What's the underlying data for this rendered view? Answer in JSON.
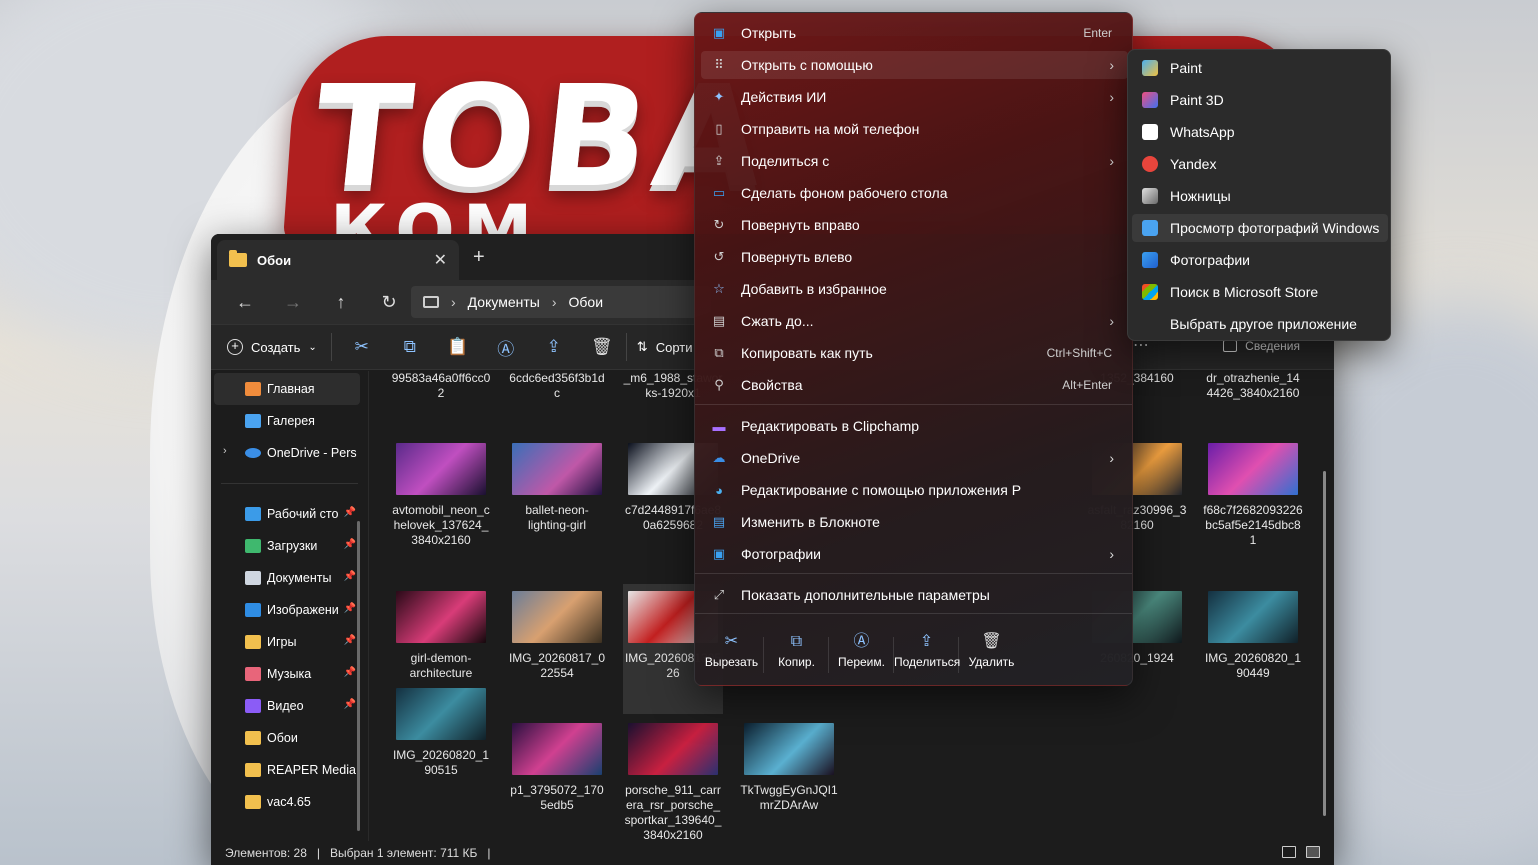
{
  "wallpaper": {
    "logo_line1": "ТОВА",
    "logo_line2": "КОМ"
  },
  "explorer": {
    "tab_title": "Обои",
    "new_tab": "+",
    "breadcrumb": [
      "Документы",
      "Обои"
    ],
    "toolbar": {
      "create_label": "Создать",
      "sort_label": "Сорти",
      "details_label": "Сведения"
    },
    "sidebar": [
      {
        "label": "Главная",
        "icon": "home-icon",
        "active": true
      },
      {
        "label": "Галерея",
        "icon": "gallery-icon"
      },
      {
        "label": "OneDrive - Pers",
        "icon": "onedrive-icon",
        "expandable": true
      },
      {
        "label": "Рабочий сто",
        "icon": "desktop-icon",
        "pinned": true
      },
      {
        "label": "Загрузки",
        "icon": "download-icon",
        "pinned": true
      },
      {
        "label": "Документы",
        "icon": "documents-icon",
        "pinned": true
      },
      {
        "label": "Изображени",
        "icon": "pictures-icon",
        "pinned": true
      },
      {
        "label": "Игры",
        "icon": "folder-icon",
        "pinned": true
      },
      {
        "label": "Музыка",
        "icon": "music-icon",
        "pinned": true
      },
      {
        "label": "Видео",
        "icon": "video-icon",
        "pinned": true
      },
      {
        "label": "Обои",
        "icon": "folder-icon"
      },
      {
        "label": "REAPER Media",
        "icon": "folder-icon"
      },
      {
        "label": "vac4.65",
        "icon": "folder-icon"
      }
    ],
    "files": [
      {
        "name": "99583a46a0ff6cc02",
        "thumb": false
      },
      {
        "name": "6cdc6ed356f3b1dc",
        "thumb": false
      },
      {
        "name": "_m6_1988_staworks-1920x1",
        "thumb": false
      },
      {
        "name": "1352_384160",
        "thumb": false
      },
      {
        "name": "dr_otrazhenie_144426_3840x2160",
        "thumb": false
      },
      {
        "name": "avtomobil_neon_chelovek_137624_3840x2160"
      },
      {
        "name": "ballet-neon-lighting-girl"
      },
      {
        "name": "c7d2448917f6ae80a6259682"
      },
      {
        "name": "asfalt_raz30996_382160"
      },
      {
        "name": "f68c7f2682093226bc5af5e2145dbc81"
      },
      {
        "name": "girl-demon-architecture"
      },
      {
        "name": "IMG_20260817_022554"
      },
      {
        "name": "IMG_202608130526",
        "selected": true
      },
      {
        "name": "260820_1924"
      },
      {
        "name": "IMG_20260820_190449"
      },
      {
        "name": "IMG_20260820_190515"
      },
      {
        "name": "p1_3795072_1705edb5"
      },
      {
        "name": "porsche_911_carrera_rsr_porsche_sportkar_139640_3840x2160"
      },
      {
        "name": "TkTwggEyGnJQI1mrZDArAw"
      }
    ],
    "status": {
      "count": "Элементов: 28",
      "selected": "Выбран 1 элемент: 711 КБ"
    }
  },
  "context_menu": {
    "items": [
      {
        "label": "Открыть",
        "shortcut": "Enter",
        "icon": "photos-icon"
      },
      {
        "label": "Открыть с помощью",
        "submenu": true,
        "icon": "open-with-icon",
        "hover": true
      },
      {
        "label": "Действия ИИ",
        "submenu": true,
        "icon": "ai-sparkle-icon"
      },
      {
        "label": "Отправить на мой телефон",
        "icon": "phone-icon"
      },
      {
        "label": "Поделиться с",
        "submenu": true,
        "icon": "share-icon"
      },
      {
        "label": "Сделать фоном рабочего стола",
        "icon": "wallpaper-icon"
      },
      {
        "label": "Повернуть вправо",
        "icon": "rotate-right-icon"
      },
      {
        "label": "Повернуть влево",
        "icon": "rotate-left-icon"
      },
      {
        "label": "Добавить в избранное",
        "icon": "star-icon"
      },
      {
        "label": "Сжать до...",
        "submenu": true,
        "icon": "zip-icon"
      },
      {
        "label": "Копировать как путь",
        "shortcut": "Ctrl+Shift+C",
        "icon": "copy-path-icon"
      },
      {
        "label": "Свойства",
        "shortcut": "Alt+Enter",
        "icon": "wrench-icon"
      },
      {
        "label": "Редактировать в Clipchamp",
        "icon": "clipchamp-icon"
      },
      {
        "label": "OneDrive",
        "submenu": true,
        "icon": "onedrive-icon"
      },
      {
        "label": "Редактирование с помощью приложения P",
        "icon": "paint-icon"
      },
      {
        "label": "Изменить в Блокноте",
        "icon": "notepad-icon"
      },
      {
        "label": "Фотографии",
        "submenu": true,
        "icon": "photos-icon"
      },
      {
        "label": "Показать дополнительные параметры",
        "icon": "more-options-icon"
      }
    ],
    "actions": [
      {
        "label": "Вырезать",
        "icon": "cut-icon"
      },
      {
        "label": "Копир.",
        "icon": "copy-icon"
      },
      {
        "label": "Переим.",
        "icon": "rename-icon"
      },
      {
        "label": "Поделиться",
        "icon": "share-icon"
      },
      {
        "label": "Удалить",
        "icon": "delete-icon"
      }
    ]
  },
  "submenu": {
    "items": [
      {
        "label": "Paint",
        "icon": "paint-icon"
      },
      {
        "label": "Paint 3D",
        "icon": "paint3d-icon"
      },
      {
        "label": "WhatsApp",
        "icon": "whatsapp-icon"
      },
      {
        "label": "Yandex",
        "icon": "yandex-icon"
      },
      {
        "label": "Ножницы",
        "icon": "snipping-icon"
      },
      {
        "label": "Просмотр фотографий Windows",
        "icon": "photo-viewer-icon",
        "hover": true
      },
      {
        "label": "Фотографии",
        "icon": "photos-icon"
      },
      {
        "label": "Поиск в Microsoft Store",
        "icon": "store-icon"
      },
      {
        "label": "Выбрать другое приложение",
        "icon": ""
      }
    ]
  }
}
